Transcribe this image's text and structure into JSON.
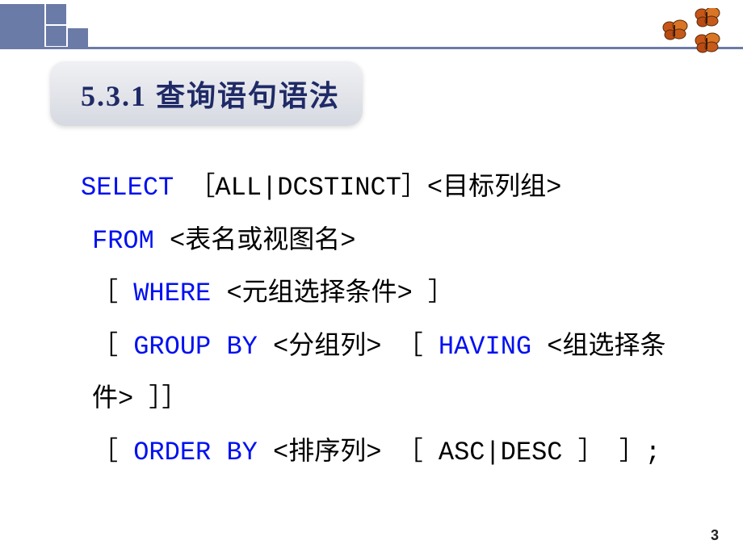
{
  "title": "5.3.1 查询语句语法",
  "code": {
    "l1a": "SELECT",
    "l1b": "［ALL|DCSTINCT］<目标列组>",
    "l2a": "FROM",
    "l2b": " <表名或视图名>",
    "l3a": "［ ",
    "l3b": "WHERE",
    "l3c": " <元组选择条件> ］",
    "l4a": "［ ",
    "l4b": "GROUP BY",
    "l4c": " <分组列> ［ ",
    "l4d": "HAVING",
    "l4e": " <组选择条件> ］］",
    "l5a": "［ ",
    "l5b": "ORDER BY",
    "l5c": " <排序列> ［ ASC|DESC ］ ］;"
  },
  "page_number": "3",
  "icons": {
    "butterfly": "butterfly-icon"
  }
}
